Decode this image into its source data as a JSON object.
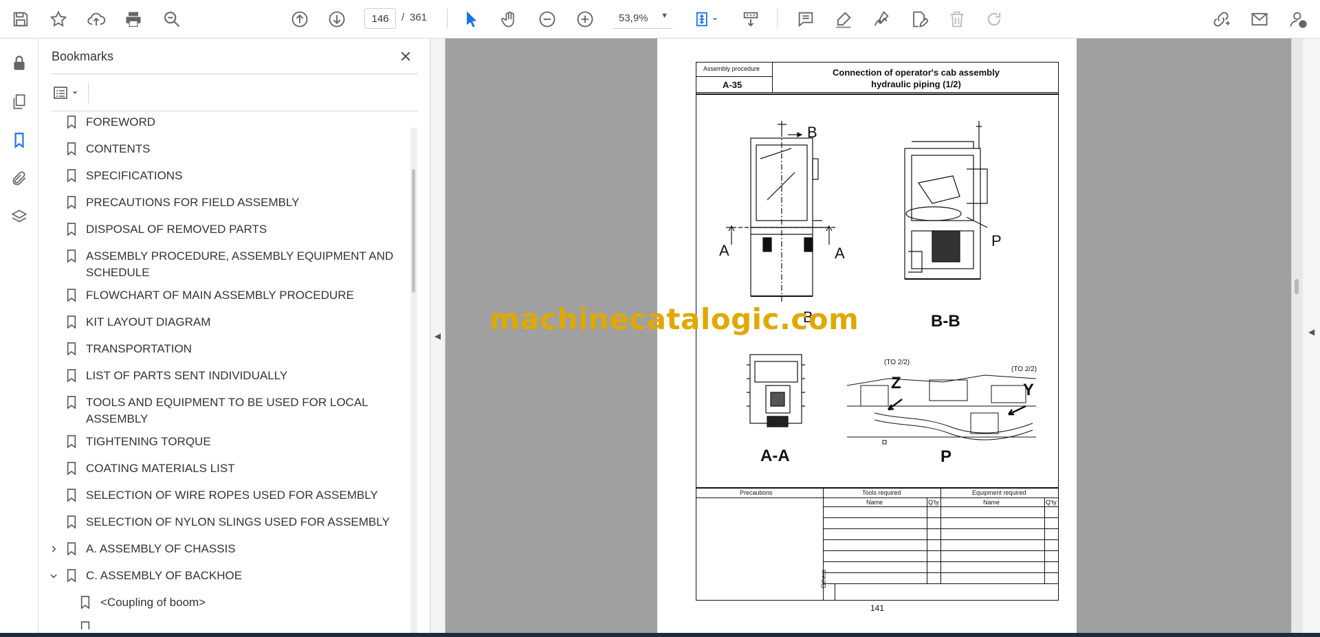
{
  "toolbar": {
    "current_page": "146",
    "page_separator": "/",
    "total_pages": "361",
    "zoom": "53,9%"
  },
  "panel": {
    "title": "Bookmarks"
  },
  "bookmarks": [
    {
      "label": "FOREWORD"
    },
    {
      "label": "CONTENTS"
    },
    {
      "label": "SPECIFICATIONS"
    },
    {
      "label": "PRECAUTIONS FOR FIELD ASSEMBLY"
    },
    {
      "label": "DISPOSAL OF REMOVED PARTS"
    },
    {
      "label": "ASSEMBLY PROCEDURE, ASSEMBLY EQUIPMENT AND",
      "label2": "SCHEDULE"
    },
    {
      "label": "FLOWCHART OF MAIN ASSEMBLY PROCEDURE"
    },
    {
      "label": "KIT LAYOUT DIAGRAM"
    },
    {
      "label": "TRANSPORTATION"
    },
    {
      "label": "LIST OF PARTS SENT INDIVIDUALLY"
    },
    {
      "label": "TOOLS AND EQUIPMENT TO BE USED FOR LOCAL",
      "label2": "ASSEMBLY"
    },
    {
      "label": "TIGHTENING TORQUE"
    },
    {
      "label": "COATING MATERIALS LIST"
    },
    {
      "label": "SELECTION OF WIRE ROPES USED FOR ASSEMBLY"
    },
    {
      "label": "SELECTION OF NYLON SLINGS USED FOR ASSEMBLY"
    },
    {
      "label": "A. ASSEMBLY OF CHASSIS",
      "toggle": "›"
    },
    {
      "label": "C. ASSEMBLY OF BACKHOE",
      "toggle": "⌄"
    },
    {
      "label": "<Coupling of boom>",
      "child": true
    }
  ],
  "document": {
    "proc_label": "Assembly procedure",
    "proc_code": "A-35",
    "title_line1": "Connection of operator's cab assembly",
    "title_line2": "hydraulic piping (1/2)",
    "fig": {
      "b_top": "B",
      "a_left": "A",
      "a_right": "A",
      "b_bottom": "B",
      "p_right": "P",
      "bb": "B-B",
      "aa": "A-A",
      "p_bottom": "P",
      "z": "Z",
      "y": "Y",
      "to1": "(TO 2/2)",
      "to2": "(TO 2/2)"
    },
    "table": {
      "precautions": "Precautions",
      "tools": "Tools required",
      "equipment": "Equipment required",
      "name": "Name",
      "qty": "Q'ty",
      "others": "Others"
    },
    "page_number": "141"
  },
  "watermark": "machinecatalogic.com"
}
